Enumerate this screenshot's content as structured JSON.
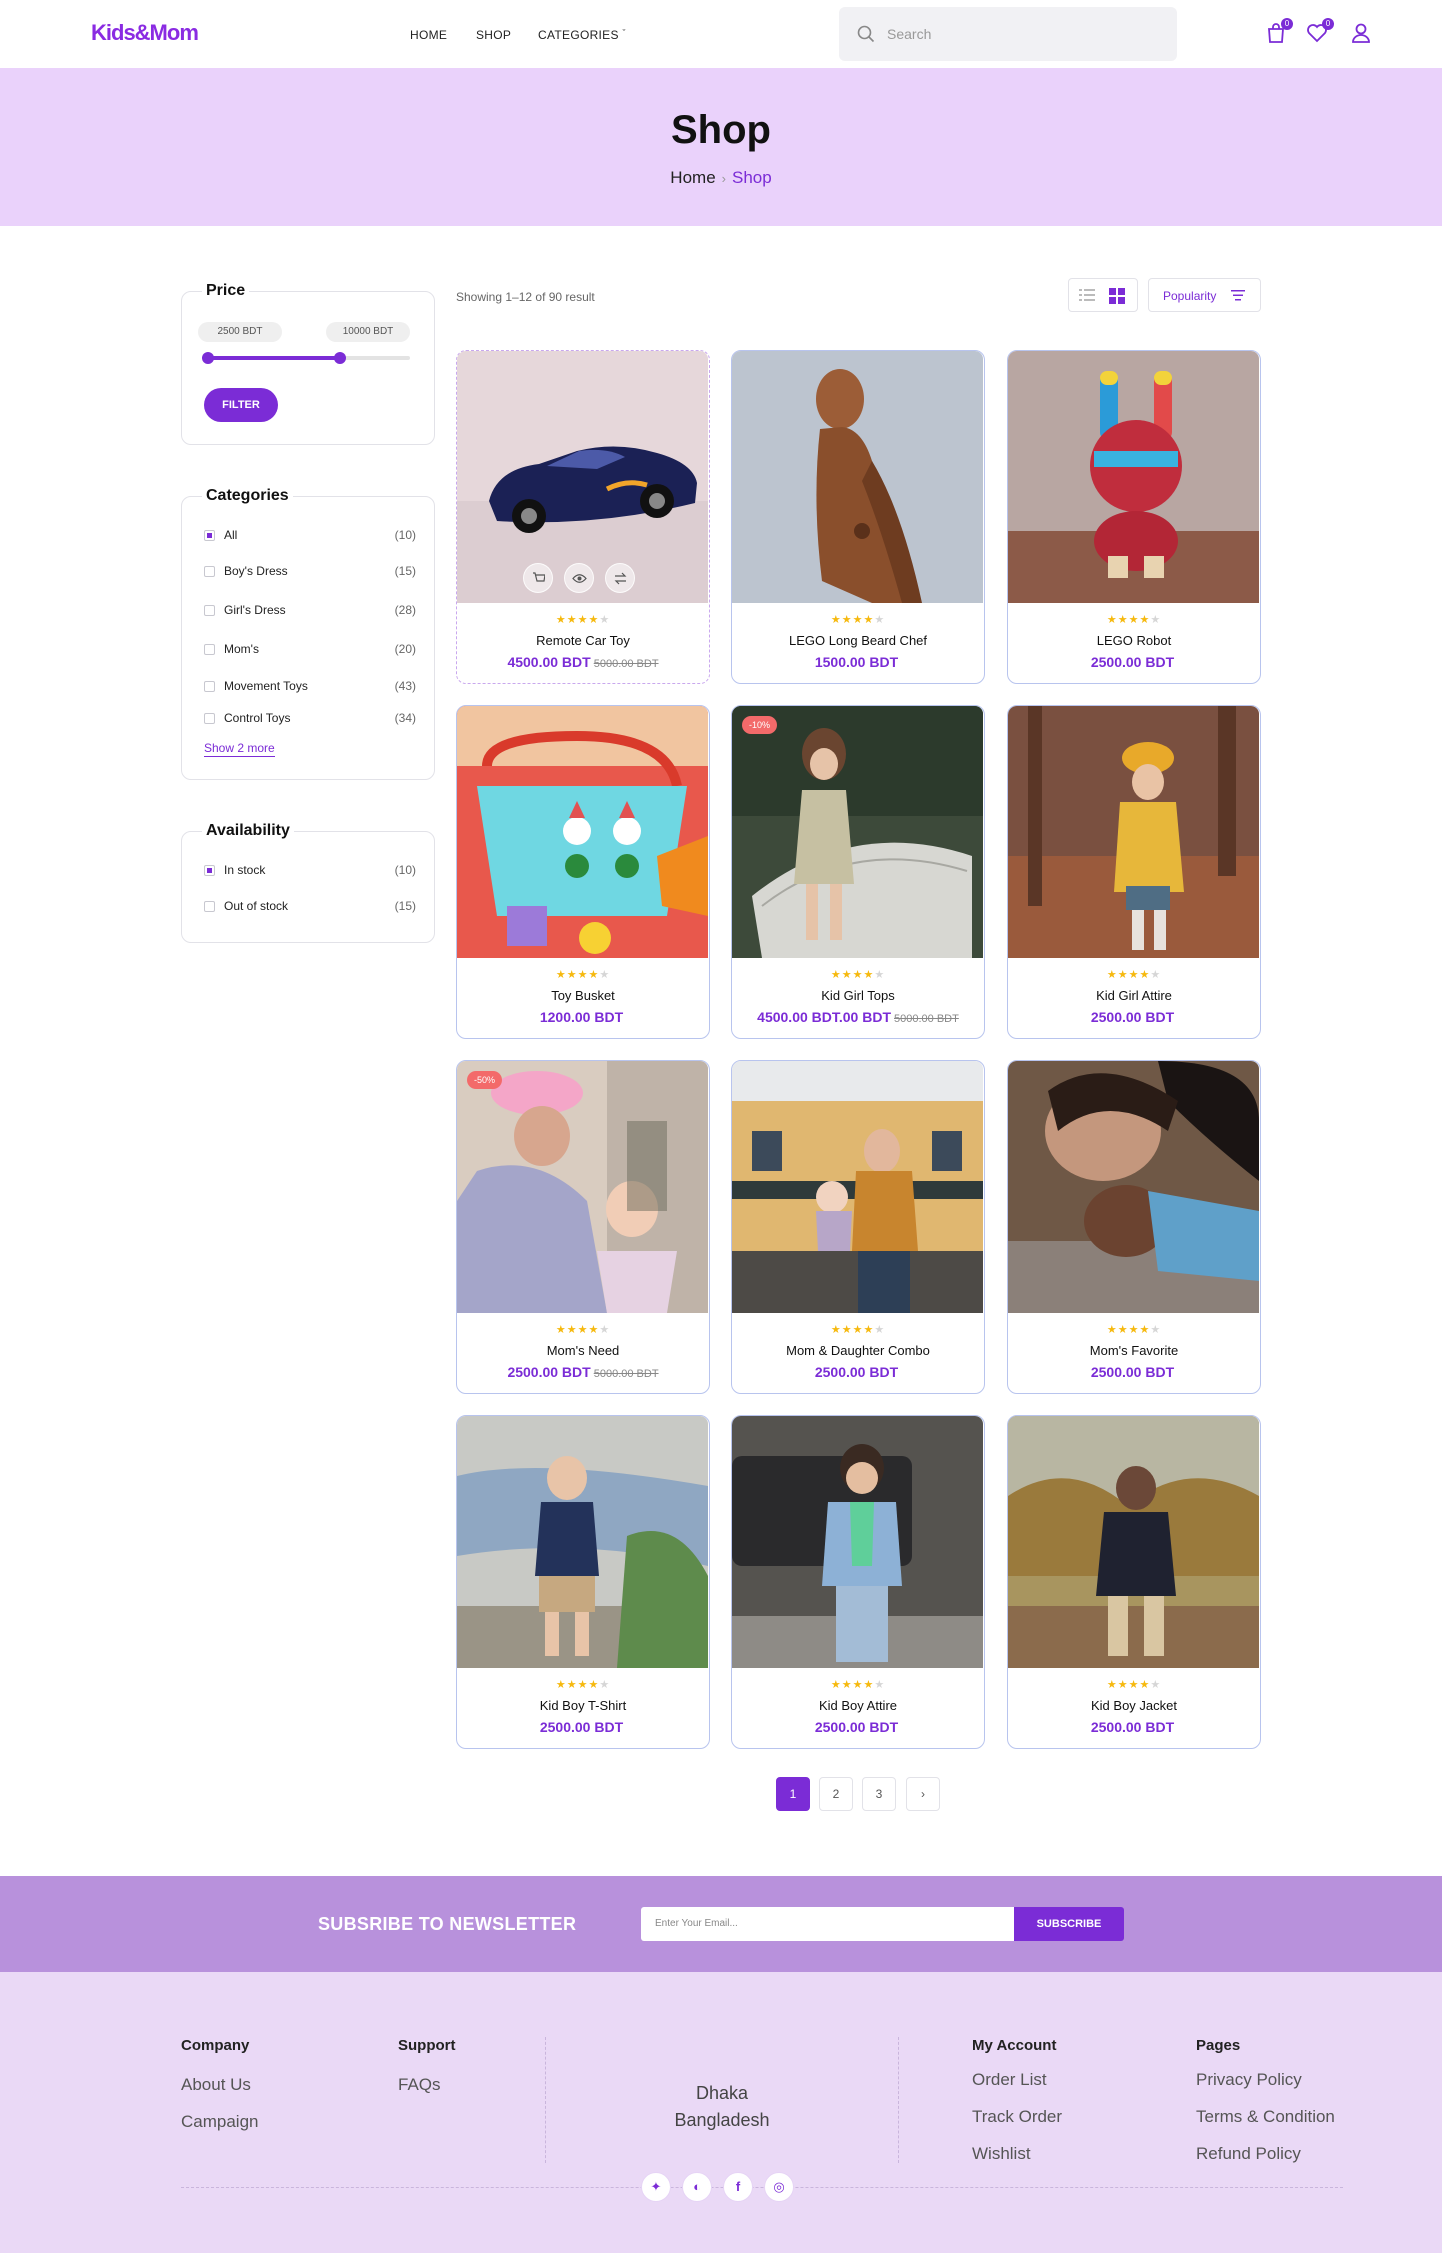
{
  "brand": {
    "logo": "Kids&Mom",
    "accent": "#7b2cd6",
    "banner_bg": "#ead2fb"
  },
  "nav": {
    "home": "HOME",
    "shop": "SHOP",
    "categories": "CATEGORIES"
  },
  "search": {
    "placeholder": "Search"
  },
  "header_icons": {
    "cart_count": "0",
    "wishlist_count": "0",
    "cart_icon": "shopping-bag-icon",
    "wishlist_icon": "heart-icon",
    "account_icon": "user-icon"
  },
  "banner": {
    "title": "Shop",
    "breadcrumb_home": "Home",
    "breadcrumb_current": "Shop"
  },
  "price_filter": {
    "title": "Price",
    "min_label": "2500 BDT",
    "max_label": "10000 BDT",
    "range_low_fraction": 0.0,
    "range_high_fraction": 0.66,
    "button": "FILTER"
  },
  "categories": {
    "title": "Categories",
    "items": [
      {
        "label": "All",
        "count": "(10)",
        "checked": true
      },
      {
        "label": "Boy's Dress",
        "count": "(15)",
        "checked": false
      },
      {
        "label": "Girl's Dress",
        "count": "(28)",
        "checked": false
      },
      {
        "label": "Mom's",
        "count": "(20)",
        "checked": false
      },
      {
        "label": "Movement Toys",
        "count": "(43)",
        "checked": false
      },
      {
        "label": "Control Toys",
        "count": "(34)",
        "checked": false
      }
    ],
    "show_more": "Show 2 more"
  },
  "availability": {
    "title": "Availability",
    "items": [
      {
        "label": "In stock",
        "count": "(10)",
        "checked": true
      },
      {
        "label": "Out of stock",
        "count": "(15)",
        "checked": false
      }
    ]
  },
  "toolbar": {
    "result_text": "Showing 1–12 of 90 result",
    "sort_label": "Popularity"
  },
  "products": [
    {
      "name": "Remote Car Toy",
      "price": "4500.00 BDT",
      "old_price": "5000.00 BDT",
      "rating": 4,
      "badge": ""
    },
    {
      "name": "LEGO Long Beard Chef",
      "price": "1500.00 BDT",
      "old_price": "",
      "rating": 4,
      "badge": ""
    },
    {
      "name": "LEGO Robot",
      "price": "2500.00 BDT",
      "old_price": "",
      "rating": 4,
      "badge": ""
    },
    {
      "name": "Toy Busket",
      "price": "1200.00 BDT",
      "old_price": "",
      "rating": 4,
      "badge": ""
    },
    {
      "name": "Kid Girl Tops",
      "price": "4500.00 BDT.00 BDT",
      "old_price": "5000.00 BDT",
      "rating": 4,
      "badge": "-10%"
    },
    {
      "name": "Kid Girl Attire",
      "price": "2500.00 BDT",
      "old_price": "",
      "rating": 4,
      "badge": ""
    },
    {
      "name": "Mom's Need",
      "price": "2500.00 BDT",
      "old_price": "5000.00 BDT",
      "rating": 4,
      "badge": "-50%"
    },
    {
      "name": "Mom & Daughter Combo",
      "price": "2500.00 BDT",
      "old_price": "",
      "rating": 4,
      "badge": ""
    },
    {
      "name": "Mom's Favorite",
      "price": "2500.00 BDT",
      "old_price": "",
      "rating": 4,
      "badge": ""
    },
    {
      "name": "Kid Boy T-Shirt",
      "price": "2500.00 BDT",
      "old_price": "",
      "rating": 4,
      "badge": ""
    },
    {
      "name": "Kid Boy Attire",
      "price": "2500.00 BDT",
      "old_price": "",
      "rating": 4,
      "badge": ""
    },
    {
      "name": "Kid Boy Jacket",
      "price": "2500.00 BDT",
      "old_price": "",
      "rating": 4,
      "badge": ""
    }
  ],
  "pagination": {
    "pages": [
      "1",
      "2",
      "3"
    ],
    "current": "1",
    "next_icon": "chevron-right-icon"
  },
  "newsletter": {
    "title": "SUBSRIBE TO NEWSLETTER",
    "placeholder": "Enter Your Email...",
    "button": "SUBSCRIBE"
  },
  "footer": {
    "company": {
      "title": "Company",
      "links": [
        "About Us",
        "Campaign"
      ]
    },
    "support": {
      "title": "Support",
      "links": [
        "FAQs"
      ]
    },
    "address": {
      "line1": "Dhaka",
      "line2": "Bangladesh"
    },
    "account": {
      "title": "My Account",
      "links": [
        "Order List",
        "Track Order",
        "Wishlist"
      ]
    },
    "pages": {
      "title": "Pages",
      "links": [
        "Privacy Policy",
        "Terms & Condition",
        "Refund Policy"
      ]
    },
    "social": [
      "twitter-icon",
      "instagram-icon",
      "facebook-icon",
      "pinterest-icon"
    ]
  }
}
